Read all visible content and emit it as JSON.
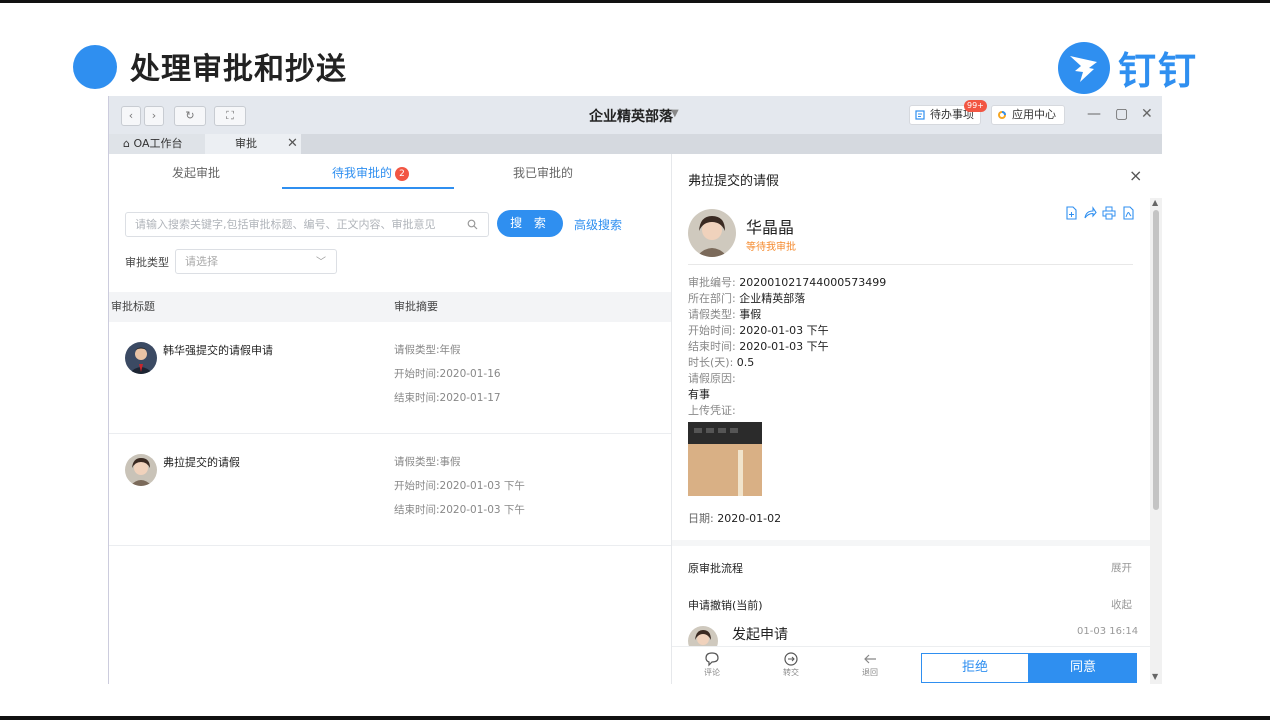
{
  "slide": {
    "title": "处理审批和抄送",
    "brand_text": "钉钉"
  },
  "window": {
    "org_title": "企业精英部落",
    "todo_label": "待办事项",
    "todo_badge": "99+",
    "app_center_label": "应用中心",
    "tabs": [
      {
        "label": "OA工作台"
      },
      {
        "label": "审批"
      }
    ]
  },
  "approval_tabs": {
    "initiate": "发起审批",
    "pending": "待我审批的",
    "pending_count": "2",
    "approved": "我已审批的"
  },
  "search": {
    "placeholder": "请输入搜索关键字,包括审批标题、编号、正文内容、审批意见",
    "button": "搜 索",
    "advanced": "高级搜索",
    "type_label": "审批类型",
    "type_placeholder": "请选择"
  },
  "table": {
    "headers": {
      "title": "审批标题",
      "summary": "审批摘要"
    },
    "rows": [
      {
        "title": "韩华强提交的请假申请",
        "summary": [
          "请假类型:年假",
          "开始时间:2020-01-16",
          "结束时间:2020-01-17"
        ]
      },
      {
        "title": "弗拉提交的请假",
        "summary": [
          "请假类型:事假",
          "开始时间:2020-01-03 下午",
          "结束时间:2020-01-03 下午"
        ]
      }
    ]
  },
  "detail": {
    "title": "弗拉提交的请假",
    "applicant": "华晶晶",
    "status": "等待我审批",
    "fields": [
      {
        "key": "审批编号:",
        "value": "202001021744000573499"
      },
      {
        "key": "所在部门:",
        "value": "企业精英部落"
      },
      {
        "key": "请假类型:",
        "value": "事假"
      },
      {
        "key": "开始时间:",
        "value": "2020-01-03 下午"
      },
      {
        "key": "结束时间:",
        "value": "2020-01-03 下午"
      },
      {
        "key": "时长(天):",
        "value": "0.5"
      }
    ],
    "reason_label": "请假原因:",
    "reason_value": "有事",
    "upload_label": "上传凭证:",
    "date_key": "日期:",
    "date_value": "2020-01-02",
    "orig_flow_label": "原审批流程",
    "orig_flow_action": "展开",
    "revoke_label": "申请撤销(当前)",
    "revoke_action": "收起",
    "flow_step": "发起申请",
    "flow_time": "01-03 16:14",
    "bottom_icons": {
      "comment": "评论",
      "transfer": "转交",
      "return": "退回"
    },
    "reject": "拒绝",
    "agree": "同意"
  },
  "colors": {
    "accent": "#2f8ff0",
    "badge": "#f25643",
    "status": "#f58a2e"
  }
}
